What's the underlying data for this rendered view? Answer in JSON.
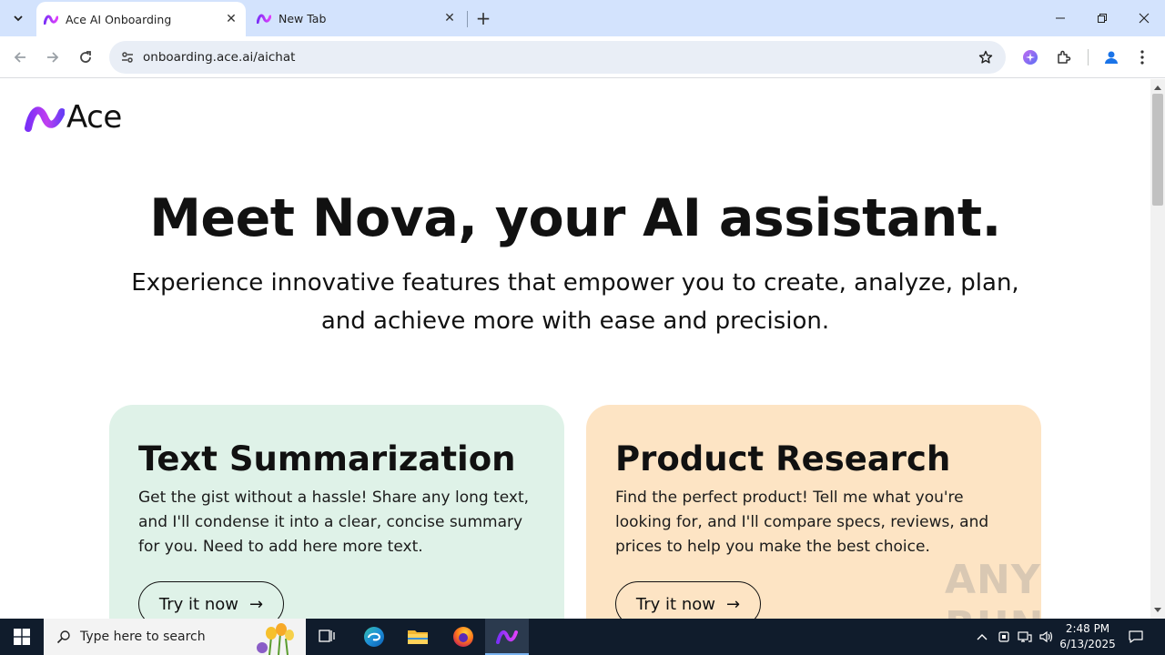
{
  "browser": {
    "tabs": [
      {
        "title": "Ace AI Onboarding",
        "active": true
      },
      {
        "title": "New Tab",
        "active": false
      }
    ],
    "url": "onboarding.ace.ai/aichat"
  },
  "page": {
    "logo_text": "Ace",
    "hero_title": "Meet Nova, your AI assistant.",
    "hero_subtitle_line1": "Experience innovative features that empower you to create, analyze, plan,",
    "hero_subtitle_line2": "and achieve more with ease and precision.",
    "cards": [
      {
        "title": "Text Summarization",
        "description": "Get the gist without a hassle! Share any long text, and I'll condense it into a clear, concise summary for you. Need to add here more text.",
        "button_label": "Try it now",
        "color": "#dff2e8"
      },
      {
        "title": "Product Research",
        "description": "Find the perfect product! Tell me what you're looking for, and I'll compare specs, reviews, and prices to help you make the best choice.",
        "button_label": "Try it now",
        "color": "#fde4c4"
      }
    ],
    "watermark": "ANY RUN"
  },
  "taskbar": {
    "search_placeholder": "Type here to search",
    "time": "2:48 PM",
    "date": "6/13/2025"
  },
  "colors": {
    "tabstrip": "#d3e3fd",
    "taskbar": "#101c2c",
    "brand_gradient_start": "#7b2ff7",
    "brand_gradient_end": "#e040fb"
  }
}
